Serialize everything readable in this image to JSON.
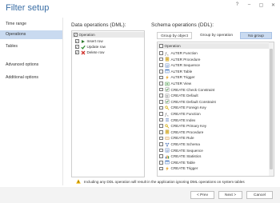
{
  "window": {
    "title": "Filter setup",
    "controls": [
      "?",
      "–",
      "▢",
      "✕"
    ]
  },
  "sidebar": {
    "items": [
      {
        "label": "Time range",
        "active": false
      },
      {
        "label": "Operations",
        "active": true
      },
      {
        "label": "Tables",
        "active": false
      },
      {
        "label": "Advanced options",
        "active": false
      },
      {
        "label": "Additional options",
        "active": false
      }
    ]
  },
  "dml": {
    "title": "Data operations (DML):",
    "header": "Operation",
    "items": [
      {
        "label": "Insert row",
        "checked": true,
        "icon": "insert-arrow-icon"
      },
      {
        "label": "Update row",
        "checked": true,
        "icon": "update-check-icon"
      },
      {
        "label": "Delete row",
        "checked": true,
        "icon": "delete-x-icon"
      }
    ]
  },
  "ddl": {
    "title": "Schema operations (DDL):",
    "grouping": [
      "Group by object",
      "Group by operation",
      "No group"
    ],
    "header": "Operation",
    "items": [
      {
        "label": "ALTER Function",
        "icon": "function-icon"
      },
      {
        "label": "ALTER Procedure",
        "icon": "procedure-icon"
      },
      {
        "label": "ALTER Sequence",
        "icon": "sequence-icon"
      },
      {
        "label": "ALTER Table",
        "icon": "table-icon"
      },
      {
        "label": "ALTER Trigger",
        "icon": "trigger-icon"
      },
      {
        "label": "ALTER View",
        "icon": "view-icon"
      },
      {
        "label": "CREATE Check Constraint",
        "icon": "constraint-icon"
      },
      {
        "label": "CREATE Default",
        "icon": "default-icon"
      },
      {
        "label": "CREATE Default Constraint",
        "icon": "constraint-icon"
      },
      {
        "label": "CREATE Foreign Key",
        "icon": "key-icon"
      },
      {
        "label": "CREATE Function",
        "icon": "function-icon"
      },
      {
        "label": "CREATE Index",
        "icon": "index-icon"
      },
      {
        "label": "CREATE Primary Key",
        "icon": "key-icon"
      },
      {
        "label": "CREATE Procedure",
        "icon": "procedure-icon"
      },
      {
        "label": "CREATE Rule",
        "icon": "rule-icon"
      },
      {
        "label": "CREATE Schema",
        "icon": "schema-icon"
      },
      {
        "label": "CREATE Sequence",
        "icon": "sequence-icon"
      },
      {
        "label": "CREATE Statistics",
        "icon": "statistics-icon"
      },
      {
        "label": "CREATE Table",
        "icon": "table-icon"
      },
      {
        "label": "CREATE Trigger",
        "icon": "trigger-icon"
      }
    ]
  },
  "warning": "Including any DDL operation will result in the application ignoring DML operations on system tables",
  "buttons": {
    "prev": "< Prev",
    "next": "Next >",
    "cancel": "Cancel"
  }
}
